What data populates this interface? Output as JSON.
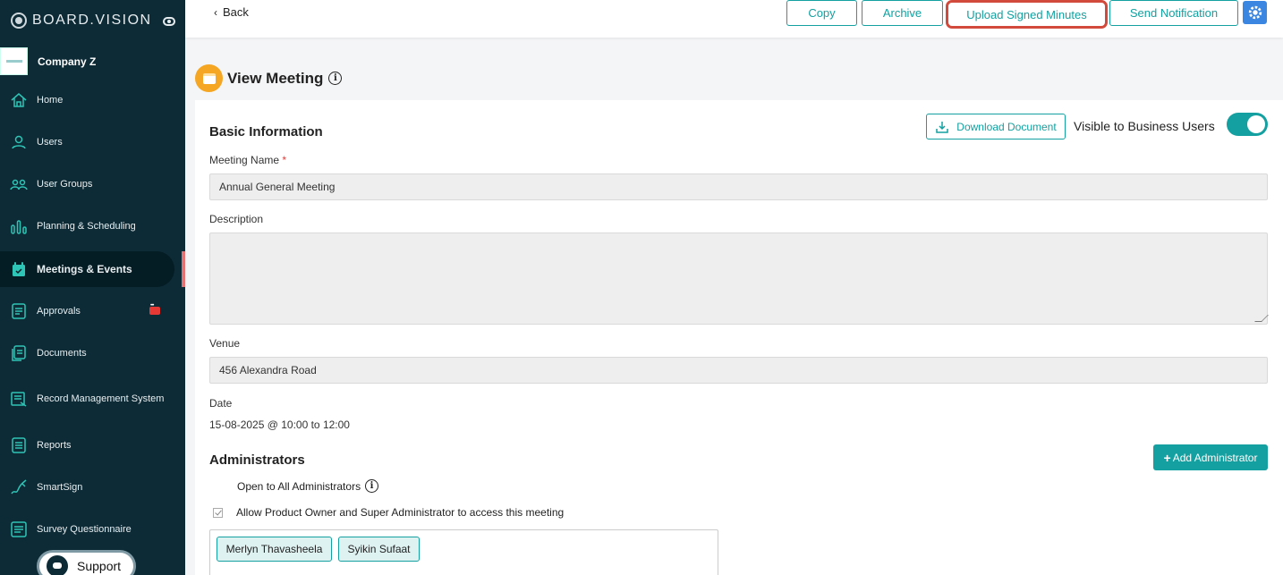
{
  "brand": {
    "name": "BOARD.VISION"
  },
  "company": {
    "name": "Company Z"
  },
  "sidebar": {
    "items": [
      {
        "label": "Home",
        "icon": "home-icon"
      },
      {
        "label": "Users",
        "icon": "user-icon"
      },
      {
        "label": "User Groups",
        "icon": "user-groups-icon"
      },
      {
        "label": "Planning & Scheduling",
        "icon": "bar-chart-icon"
      },
      {
        "label": "Meetings & Events",
        "icon": "calendar-icon",
        "active": true
      },
      {
        "label": "Approvals",
        "icon": "approvals-icon"
      },
      {
        "label": "Documents",
        "icon": "documents-icon"
      },
      {
        "label": "Record Management System",
        "icon": "record-icon"
      },
      {
        "label": "Reports",
        "icon": "reports-icon"
      },
      {
        "label": "SmartSign",
        "icon": "signature-icon"
      },
      {
        "label": "Survey Questionnaire",
        "icon": "survey-icon"
      }
    ],
    "support_label": "Support"
  },
  "topbar": {
    "back_label": "Back",
    "buttons": [
      "Copy",
      "Archive",
      "Upload Signed Minutes",
      "Send Notification"
    ]
  },
  "page": {
    "title": "View Meeting"
  },
  "basic_info": {
    "title": "Basic Information",
    "download_label": "Download Document",
    "visible_label": "Visible to Business Users",
    "visible_on": true,
    "meeting_name_label": "Meeting Name",
    "required_mark": "*",
    "meeting_name_value": "Annual General Meeting",
    "description_label": "Description",
    "description_value": "",
    "venue_label": "Venue",
    "venue_value": "456 Alexandra Road",
    "date_label": "Date",
    "date_value": "15-08-2025 @ 10:00 to 12:00"
  },
  "administrators": {
    "title": "Administrators",
    "add_label": "Add Administrator",
    "open_label": "Open to All Administrators",
    "allow_label": "Allow Product Owner and Super Administrator to access this meeting",
    "chips": [
      "Merlyn Thavasheela",
      "Syikin Sufaat"
    ]
  },
  "colors": {
    "sidebar_bg": "#0d2b36",
    "accent": "#14a0a0",
    "highlight": "#d14a3b",
    "gear_bg": "#3a86e0"
  }
}
